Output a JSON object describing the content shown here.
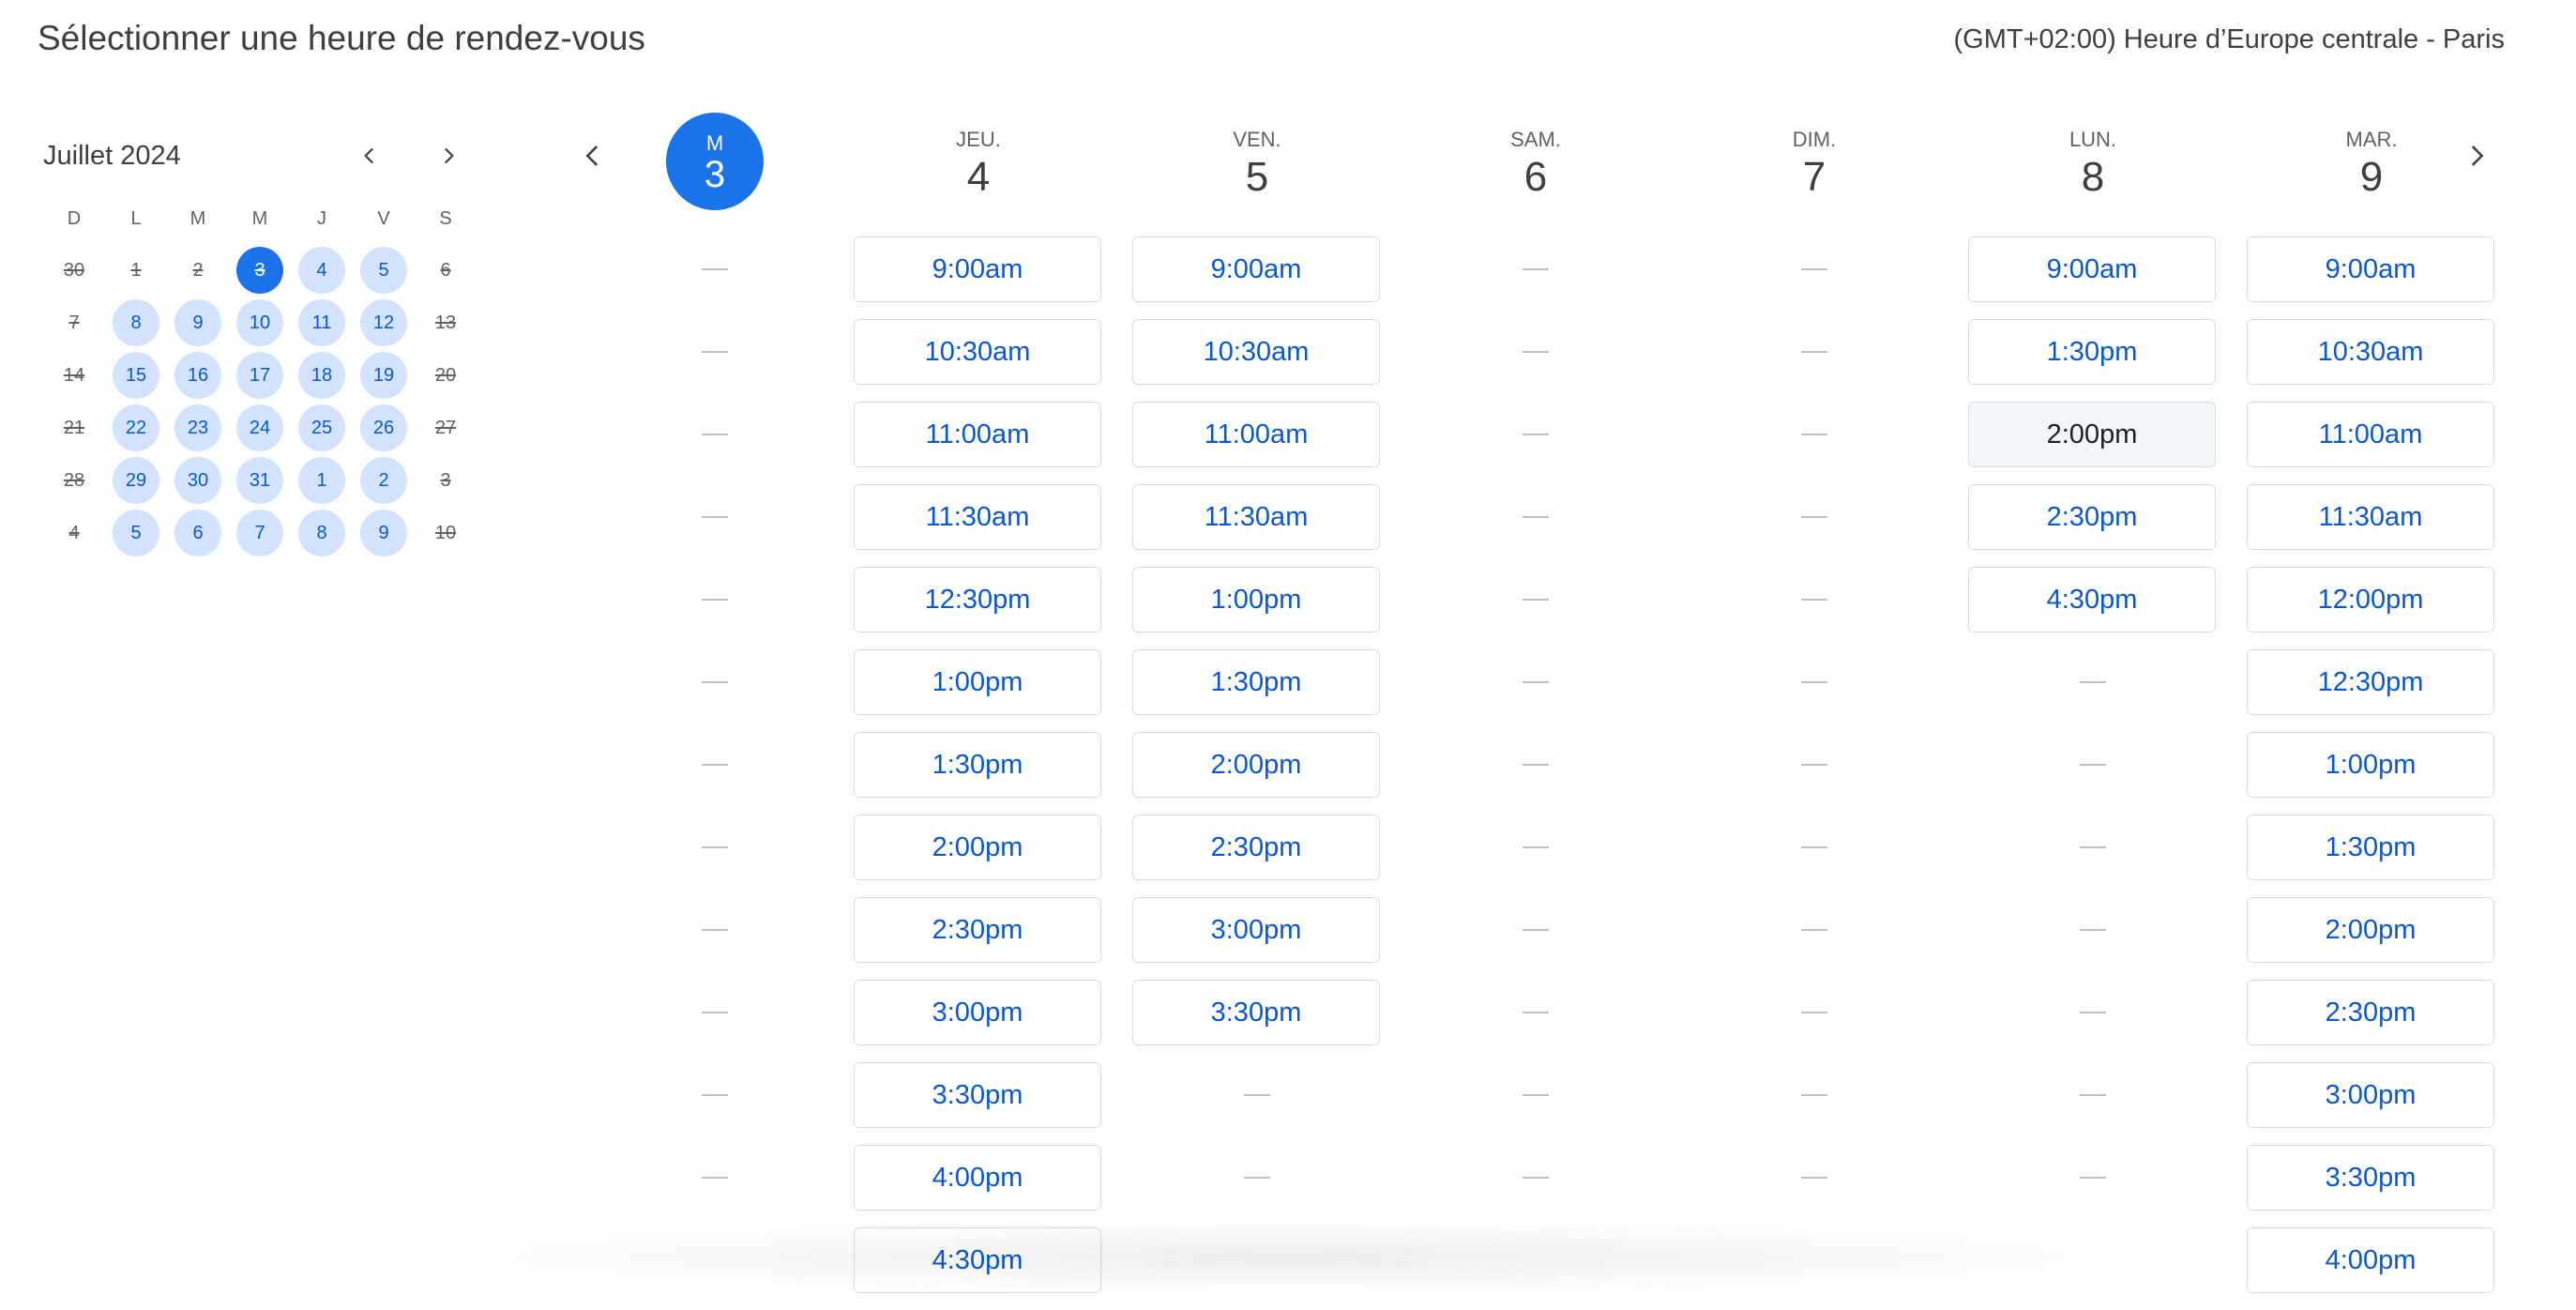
{
  "header": {
    "title": "Sélectionner une heure de rendez-vous",
    "timezone": "(GMT+02:00) Heure d’Europe centrale - Paris"
  },
  "mini_calendar": {
    "month": "Juillet 2024",
    "weekday_labels": [
      "D",
      "L",
      "M",
      "M",
      "J",
      "V",
      "S"
    ],
    "days": [
      {
        "n": "30",
        "state": "na"
      },
      {
        "n": "1",
        "state": "na"
      },
      {
        "n": "2",
        "state": "na"
      },
      {
        "n": "3",
        "state": "sel"
      },
      {
        "n": "4",
        "state": "av"
      },
      {
        "n": "5",
        "state": "av"
      },
      {
        "n": "6",
        "state": "na"
      },
      {
        "n": "7",
        "state": "na"
      },
      {
        "n": "8",
        "state": "av"
      },
      {
        "n": "9",
        "state": "av"
      },
      {
        "n": "10",
        "state": "av"
      },
      {
        "n": "11",
        "state": "av"
      },
      {
        "n": "12",
        "state": "av"
      },
      {
        "n": "13",
        "state": "na"
      },
      {
        "n": "14",
        "state": "na"
      },
      {
        "n": "15",
        "state": "av"
      },
      {
        "n": "16",
        "state": "av"
      },
      {
        "n": "17",
        "state": "av"
      },
      {
        "n": "18",
        "state": "av"
      },
      {
        "n": "19",
        "state": "av"
      },
      {
        "n": "20",
        "state": "na"
      },
      {
        "n": "21",
        "state": "na"
      },
      {
        "n": "22",
        "state": "av"
      },
      {
        "n": "23",
        "state": "av"
      },
      {
        "n": "24",
        "state": "av"
      },
      {
        "n": "25",
        "state": "av"
      },
      {
        "n": "26",
        "state": "av"
      },
      {
        "n": "27",
        "state": "na"
      },
      {
        "n": "28",
        "state": "na"
      },
      {
        "n": "29",
        "state": "av"
      },
      {
        "n": "30",
        "state": "av"
      },
      {
        "n": "31",
        "state": "av"
      },
      {
        "n": "1",
        "state": "av"
      },
      {
        "n": "2",
        "state": "av"
      },
      {
        "n": "3",
        "state": "na"
      },
      {
        "n": "4",
        "state": "na"
      },
      {
        "n": "5",
        "state": "av"
      },
      {
        "n": "6",
        "state": "av"
      },
      {
        "n": "7",
        "state": "av"
      },
      {
        "n": "8",
        "state": "av"
      },
      {
        "n": "9",
        "state": "av"
      },
      {
        "n": "10",
        "state": "na"
      }
    ]
  },
  "week": {
    "columns": [
      {
        "dow": "M",
        "num": "3",
        "today": true,
        "slots": [
          null,
          null,
          null,
          null,
          null,
          null,
          null,
          null,
          null,
          null,
          null,
          null
        ]
      },
      {
        "dow": "JEU.",
        "num": "4",
        "slots": [
          "9:00am",
          "10:30am",
          "11:00am",
          "11:30am",
          "12:30pm",
          "1:00pm",
          "1:30pm",
          "2:00pm",
          "2:30pm",
          "3:00pm",
          "3:30pm",
          "4:00pm",
          "4:30pm"
        ]
      },
      {
        "dow": "VEN.",
        "num": "5",
        "slots": [
          "9:00am",
          "10:30am",
          "11:00am",
          "11:30am",
          "1:00pm",
          "1:30pm",
          "2:00pm",
          "2:30pm",
          "3:00pm",
          "3:30pm",
          null,
          null
        ]
      },
      {
        "dow": "SAM.",
        "num": "6",
        "slots": [
          null,
          null,
          null,
          null,
          null,
          null,
          null,
          null,
          null,
          null,
          null,
          null
        ]
      },
      {
        "dow": "DIM.",
        "num": "7",
        "slots": [
          null,
          null,
          null,
          null,
          null,
          null,
          null,
          null,
          null,
          null,
          null,
          null
        ]
      },
      {
        "dow": "LUN.",
        "num": "8",
        "slots": [
          "9:00am",
          "1:30pm",
          "2:00pm",
          "2:30pm",
          "4:30pm",
          null,
          null,
          null,
          null,
          null,
          null,
          null
        ],
        "hover_index": 2
      },
      {
        "dow": "MAR.",
        "num": "9",
        "slots": [
          "9:00am",
          "10:30am",
          "11:00am",
          "11:30am",
          "12:00pm",
          "12:30pm",
          "1:00pm",
          "1:30pm",
          "2:00pm",
          "2:30pm",
          "3:00pm",
          "3:30pm",
          "4:00pm"
        ]
      }
    ]
  },
  "icons": {
    "prev": "chevron-left-icon",
    "next": "chevron-right-icon"
  },
  "colors": {
    "accent": "#1a73e8",
    "available_bg": "#d3e3fd",
    "slot_text": "#0b57d0"
  }
}
